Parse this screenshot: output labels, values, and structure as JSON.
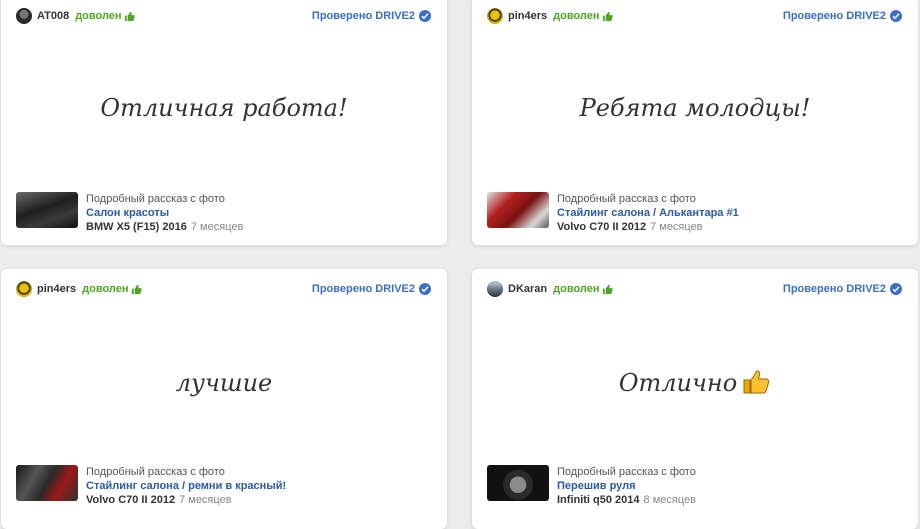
{
  "reviews": [
    {
      "user": "AT008",
      "status": "доволен",
      "verified": "Проверено DRIVE2",
      "quote": "Отличная работа!",
      "story_kind": "Подробный рассказ с фото",
      "story_title": "Салон красоты",
      "car": "BMW X5 (F15) 2016",
      "ago": "7 месяцев",
      "avatar_color": "#4a4a4a",
      "photo_color": "#2a2a2a"
    },
    {
      "user": "pin4ers",
      "status": "доволен",
      "verified": "Проверено DRIVE2",
      "quote": "Ребята молодцы!",
      "story_kind": "Подробный рассказ с фото",
      "story_title": "Стайлинг салона / Алькантара #1",
      "car": "Volvo C70 II 2012",
      "ago": "7 месяцев",
      "avatar_color": "#e6b800",
      "photo_color": "#a32020"
    },
    {
      "user": "pin4ers",
      "status": "доволен",
      "verified": "Проверено DRIVE2",
      "quote": "лучшие",
      "story_kind": "Подробный рассказ с фото",
      "story_title": "Стайлинг салона / ремни в красный!",
      "car": "Volvo C70 II 2012",
      "ago": "7 месяцев",
      "avatar_color": "#e6b800",
      "photo_color": "#3a3a3a"
    },
    {
      "user": "DKaran",
      "status": "доволен",
      "verified": "Проверено DRIVE2",
      "quote": "Отлично",
      "story_kind": "Подробный рассказ с фото",
      "story_title": "Перешив руля",
      "car": "Infiniti q50 2014",
      "ago": "8 месяцев",
      "avatar_color": "#5a6b7a",
      "photo_color": "#242424"
    }
  ],
  "colors": {
    "status_green": "#4fa524",
    "verified_blue": "#3a6fc4",
    "link_blue": "#2b5aa6"
  }
}
